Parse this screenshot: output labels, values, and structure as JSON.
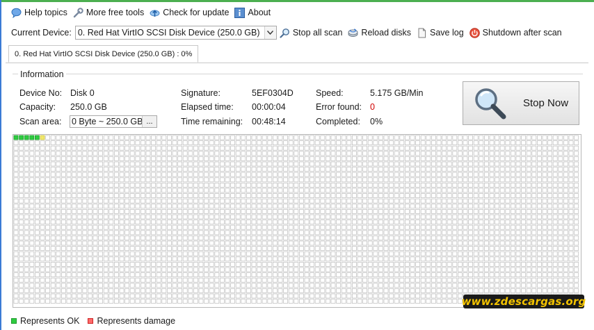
{
  "toolbar": {
    "help": "Help topics",
    "tools": "More free tools",
    "update": "Check for update",
    "about": "About"
  },
  "device_bar": {
    "label": "Current Device:",
    "selected": "0. Red Hat VirtIO SCSI Disk Device (250.0 GB)",
    "stop_all": "Stop all scan",
    "reload": "Reload disks",
    "save_log": "Save log",
    "shutdown": "Shutdown after scan"
  },
  "tab": {
    "label": "0. Red Hat VirtIO SCSI Disk Device (250.0 GB) : 0%"
  },
  "info": {
    "title": "Information",
    "device_no_label": "Device No:",
    "device_no": "Disk 0",
    "capacity_label": "Capacity:",
    "capacity": "250.0 GB",
    "scan_area_label": "Scan area:",
    "scan_area": "0 Byte ~ 250.0 GB",
    "scan_area_btn": "...",
    "signature_label": "Signature:",
    "signature": "5EF0304D",
    "elapsed_label": "Elapsed time:",
    "elapsed": "00:00:04",
    "remaining_label": "Time remaining:",
    "remaining": "00:48:14",
    "speed_label": "Speed:",
    "speed": "5.175 GB/Min",
    "errors_label": "Error found:",
    "errors": "0",
    "completed_label": "Completed:",
    "completed": "0%"
  },
  "stop_button": {
    "label": "Stop Now"
  },
  "blocks": {
    "ok_count": 5,
    "in_progress": 1,
    "ok_color": "#2ecc40",
    "progress_color": "#f1e86a",
    "empty_color": "#ffffff"
  },
  "legend": {
    "ok": "Represents OK",
    "damage": "Represents damage"
  },
  "watermark": {
    "text": "www.zdescargas.org"
  },
  "colors": {
    "accent_top": "#4caf50",
    "error_value": "#d00000"
  }
}
